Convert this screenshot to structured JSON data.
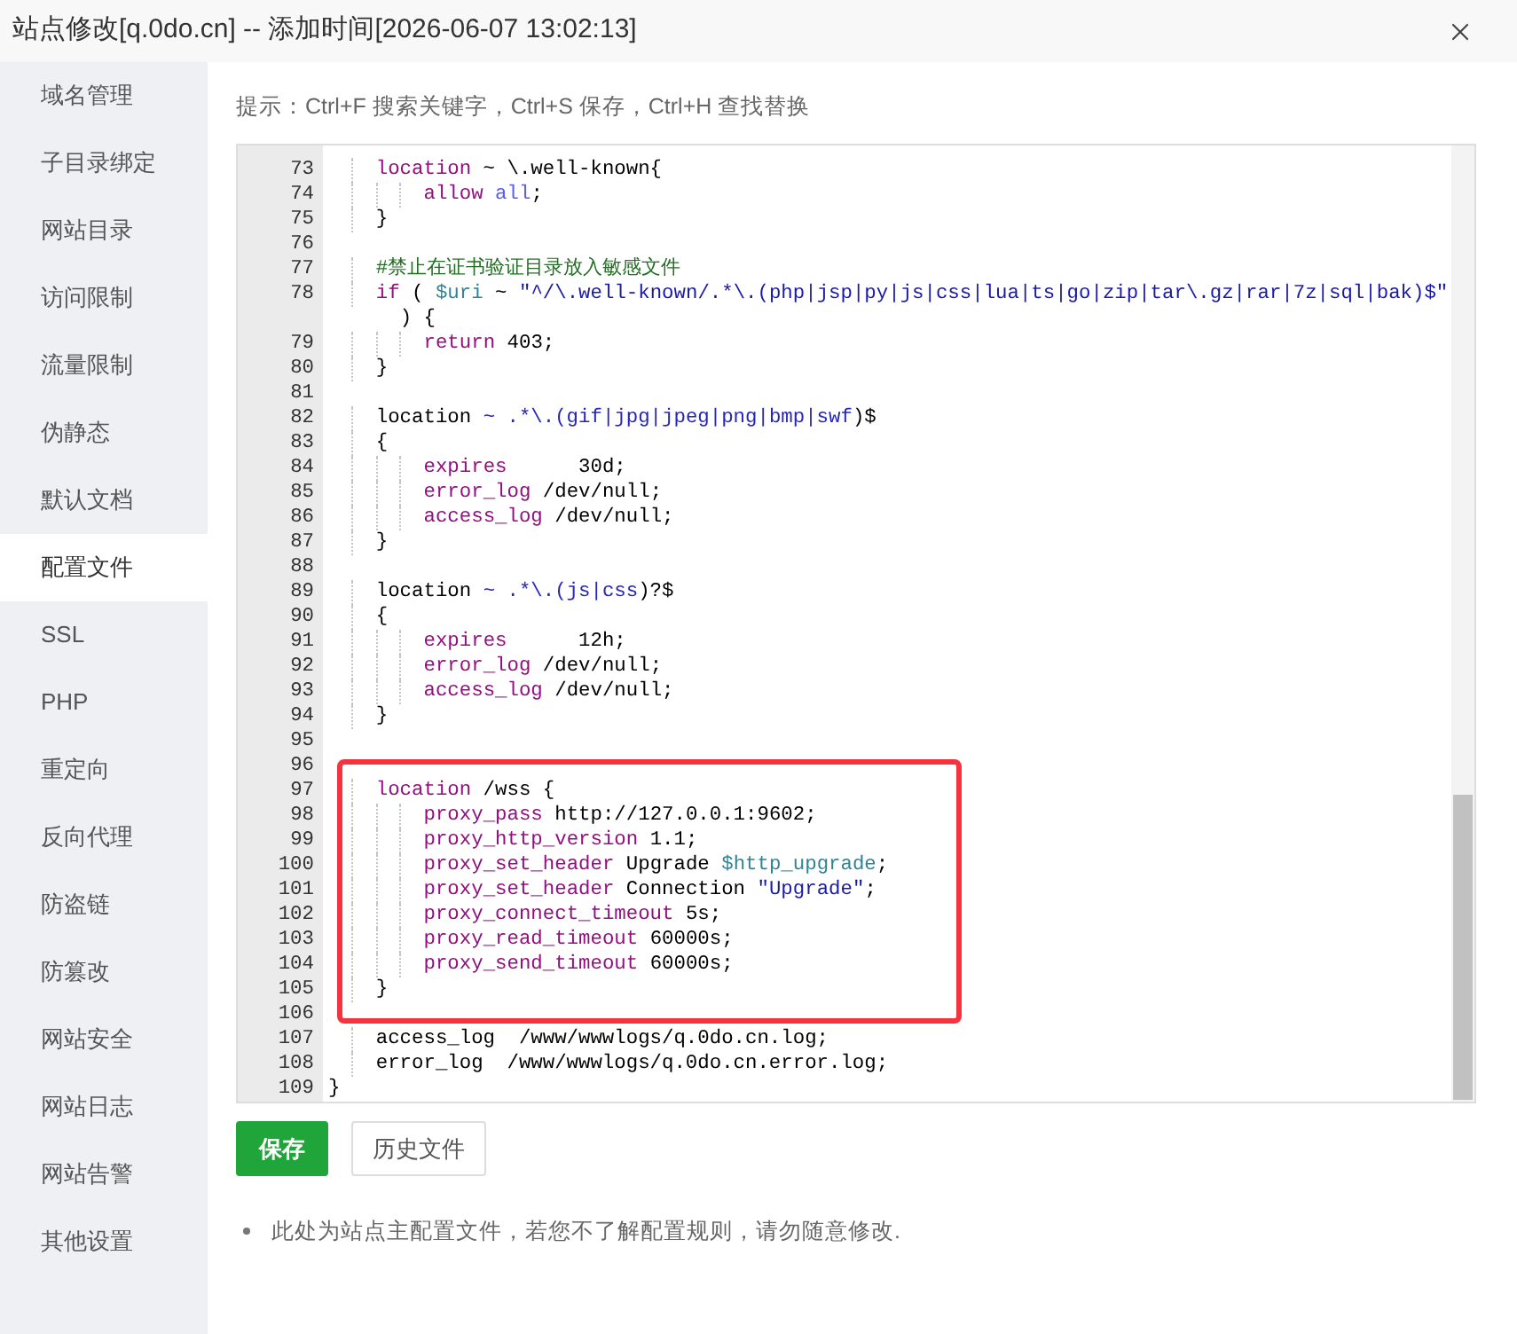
{
  "window": {
    "title": "站点修改[q.0do.cn] -- 添加时间[2026-06-07 13:02:13]"
  },
  "sidebar": {
    "items": [
      {
        "label": "域名管理",
        "selected": false
      },
      {
        "label": "子目录绑定",
        "selected": false
      },
      {
        "label": "网站目录",
        "selected": false
      },
      {
        "label": "访问限制",
        "selected": false
      },
      {
        "label": "流量限制",
        "selected": false
      },
      {
        "label": "伪静态",
        "selected": false
      },
      {
        "label": "默认文档",
        "selected": false
      },
      {
        "label": "配置文件",
        "selected": true
      },
      {
        "label": "SSL",
        "selected": false
      },
      {
        "label": "PHP",
        "selected": false
      },
      {
        "label": "重定向",
        "selected": false
      },
      {
        "label": "反向代理",
        "selected": false
      },
      {
        "label": "防盗链",
        "selected": false
      },
      {
        "label": "防篡改",
        "selected": false
      },
      {
        "label": "网站安全",
        "selected": false
      },
      {
        "label": "网站日志",
        "selected": false
      },
      {
        "label": "网站告警",
        "selected": false
      },
      {
        "label": "其他设置",
        "selected": false
      }
    ]
  },
  "hint": "提示：Ctrl+F 搜索关键字，Ctrl+S 保存，Ctrl+H 查找替换",
  "editor": {
    "lines": [
      {
        "number": "73",
        "tokens": [
          {
            "kind": "keyword",
            "text": "    location"
          },
          {
            "kind": "plain",
            "text": " ~ \\.well-known{"
          }
        ]
      },
      {
        "number": "74",
        "tokens": [
          {
            "kind": "keyword",
            "text": "        allow"
          },
          {
            "kind": "constant",
            "text": " all"
          },
          {
            "kind": "plain",
            "text": ";"
          }
        ]
      },
      {
        "number": "75",
        "tokens": [
          {
            "kind": "plain",
            "text": "    }"
          }
        ]
      },
      {
        "number": "76"
      },
      {
        "number": "77",
        "tokens": [
          {
            "kind": "comment",
            "text": "    #禁止在证书验证目录放入敏感文件"
          }
        ]
      },
      {
        "number": "78",
        "tokens": [
          {
            "kind": "keyword",
            "text": "    if"
          },
          {
            "kind": "plain",
            "text": " ( "
          },
          {
            "kind": "variable",
            "text": "$uri"
          },
          {
            "kind": "plain",
            "text": " ~ "
          },
          {
            "kind": "string",
            "text": "\"^/\\.well-known/.*\\.(php|jsp|py|js|css|lua|ts|go|zip|tar\\.gz|rar|7z|sql|bak)$\""
          },
          {
            "kind": "plain",
            "text": " ) {"
          }
        ]
      },
      {
        "number": "79",
        "tokens": [
          {
            "kind": "keyword",
            "text": "        return"
          },
          {
            "kind": "plain",
            "text": " 403;"
          }
        ]
      },
      {
        "number": "80",
        "tokens": [
          {
            "kind": "plain",
            "text": "    }"
          }
        ]
      },
      {
        "number": "81"
      },
      {
        "number": "82",
        "tokens": [
          {
            "kind": "plain",
            "text": "    location "
          },
          {
            "kind": "regex",
            "text": "~ .*\\.(gif|jpg|jpeg|png|bmp|swf"
          },
          {
            "kind": "plain",
            "text": ")$"
          }
        ]
      },
      {
        "number": "83",
        "tokens": [
          {
            "kind": "plain",
            "text": "    {"
          }
        ]
      },
      {
        "number": "84",
        "tokens": [
          {
            "kind": "keyword",
            "text": "        expires"
          },
          {
            "kind": "plain",
            "text": "      30d;"
          }
        ]
      },
      {
        "number": "85",
        "tokens": [
          {
            "kind": "keyword",
            "text": "        error_log"
          },
          {
            "kind": "plain",
            "text": " /dev/null;"
          }
        ]
      },
      {
        "number": "86",
        "tokens": [
          {
            "kind": "keyword",
            "text": "        access_log"
          },
          {
            "kind": "plain",
            "text": " /dev/null;"
          }
        ]
      },
      {
        "number": "87",
        "tokens": [
          {
            "kind": "plain",
            "text": "    }"
          }
        ]
      },
      {
        "number": "88"
      },
      {
        "number": "89",
        "tokens": [
          {
            "kind": "plain",
            "text": "    location "
          },
          {
            "kind": "regex",
            "text": "~ .*\\.(js|css"
          },
          {
            "kind": "plain",
            "text": ")?$"
          }
        ]
      },
      {
        "number": "90",
        "tokens": [
          {
            "kind": "plain",
            "text": "    {"
          }
        ]
      },
      {
        "number": "91",
        "tokens": [
          {
            "kind": "keyword",
            "text": "        expires"
          },
          {
            "kind": "plain",
            "text": "      12h;"
          }
        ]
      },
      {
        "number": "92",
        "tokens": [
          {
            "kind": "keyword",
            "text": "        error_log"
          },
          {
            "kind": "plain",
            "text": " /dev/null;"
          }
        ]
      },
      {
        "number": "93",
        "tokens": [
          {
            "kind": "keyword",
            "text": "        access_log"
          },
          {
            "kind": "plain",
            "text": " /dev/null;"
          }
        ]
      },
      {
        "number": "94",
        "tokens": [
          {
            "kind": "plain",
            "text": "    }"
          }
        ]
      },
      {
        "number": "95"
      },
      {
        "number": "96"
      },
      {
        "number": "97",
        "tokens": [
          {
            "kind": "keyword",
            "text": "    location"
          },
          {
            "kind": "plain",
            "text": " /wss {"
          }
        ]
      },
      {
        "number": "98",
        "tokens": [
          {
            "kind": "keyword",
            "text": "        proxy_pass"
          },
          {
            "kind": "plain",
            "text": " http://127.0.0.1:9602;"
          }
        ]
      },
      {
        "number": "99",
        "tokens": [
          {
            "kind": "keyword",
            "text": "        proxy_http_version"
          },
          {
            "kind": "plain",
            "text": " 1.1;"
          }
        ]
      },
      {
        "number": "100",
        "tokens": [
          {
            "kind": "keyword",
            "text": "        proxy_set_header"
          },
          {
            "kind": "plain",
            "text": " Upgrade "
          },
          {
            "kind": "variable",
            "text": "$http_upgrade"
          },
          {
            "kind": "plain",
            "text": ";"
          }
        ]
      },
      {
        "number": "101",
        "tokens": [
          {
            "kind": "keyword",
            "text": "        proxy_set_header"
          },
          {
            "kind": "plain",
            "text": " Connection "
          },
          {
            "kind": "string",
            "text": "\"Upgrade\""
          },
          {
            "kind": "plain",
            "text": ";"
          }
        ]
      },
      {
        "number": "102",
        "tokens": [
          {
            "kind": "keyword",
            "text": "        proxy_connect_timeout"
          },
          {
            "kind": "plain",
            "text": " 5s;"
          }
        ]
      },
      {
        "number": "103",
        "tokens": [
          {
            "kind": "keyword",
            "text": "        proxy_read_timeout"
          },
          {
            "kind": "plain",
            "text": " 60000s;"
          }
        ]
      },
      {
        "number": "104",
        "tokens": [
          {
            "kind": "keyword",
            "text": "        proxy_send_timeout"
          },
          {
            "kind": "plain",
            "text": " 60000s;"
          }
        ]
      },
      {
        "number": "105",
        "tokens": [
          {
            "kind": "plain",
            "text": "    }"
          }
        ]
      },
      {
        "number": "106"
      },
      {
        "number": "107",
        "tokens": [
          {
            "kind": "plain",
            "text": "    access_log  /www/wwwlogs/q.0do.cn.log;"
          }
        ]
      },
      {
        "number": "108",
        "tokens": [
          {
            "kind": "plain",
            "text": "    error_log  /www/wwwlogs/q.0do.cn.error.log;"
          }
        ]
      },
      {
        "number": "109",
        "tokens": [
          {
            "kind": "plain",
            "text": "}"
          }
        ]
      }
    ]
  },
  "buttons": [
    {
      "label": "保存",
      "kind": "primary"
    },
    {
      "label": "历史文件",
      "kind": "default"
    }
  ],
  "notes": [
    "此处为站点主配置文件，若您不了解配置规则，请勿随意修改."
  ]
}
